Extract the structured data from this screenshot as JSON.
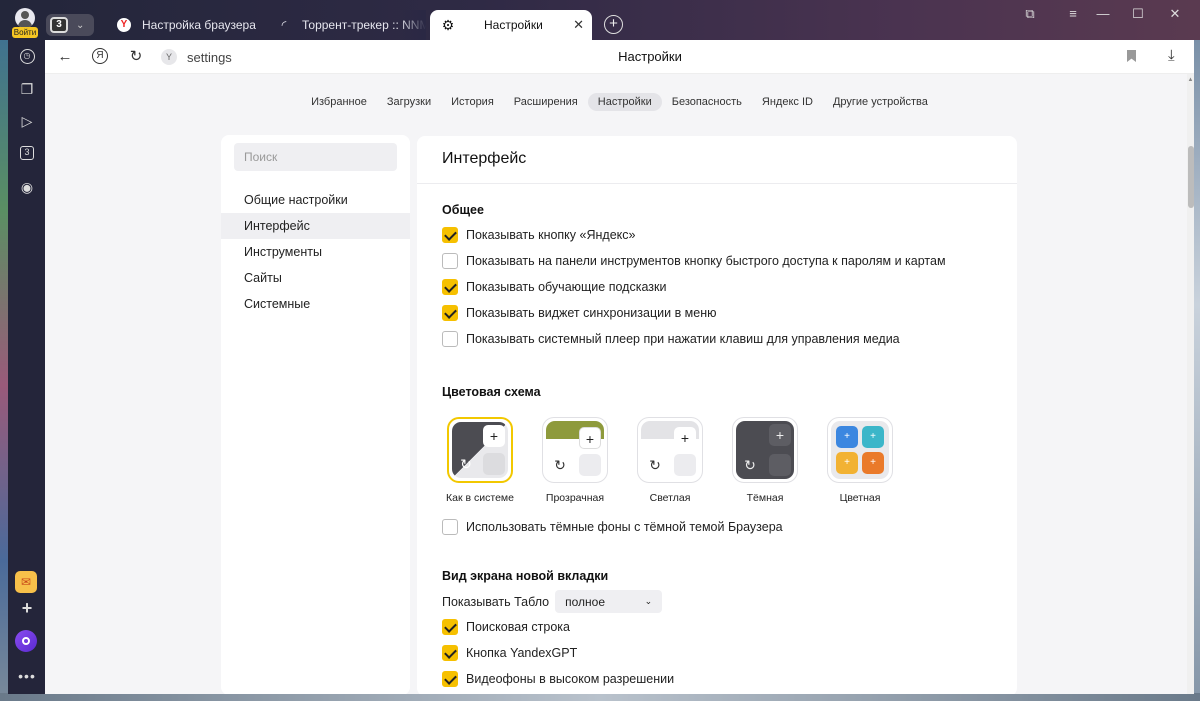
{
  "titlebar": {
    "profile_label": "Войти",
    "tab_count": "3",
    "tabs": [
      {
        "title": "Настройка браузера",
        "icon": "yandex-icon"
      },
      {
        "title": "Торрент-трекер :: NNM-C",
        "icon": "loading-icon"
      },
      {
        "title": "Настройки",
        "icon": "gear-icon",
        "close": "✕"
      }
    ],
    "new_tab": "+",
    "window_controls": [
      "⧉",
      "▭",
      "—",
      "☐",
      "✕"
    ]
  },
  "sidebar": {
    "zen_badge": "3",
    "more": "•••",
    "add": "+"
  },
  "addressbar": {
    "url": "settings",
    "page_title": "Настройки",
    "yandex_btn": "Я"
  },
  "topnav": {
    "items": [
      "Избранное",
      "Загрузки",
      "История",
      "Расширения",
      "Настройки",
      "Безопасность",
      "Яндекс ID",
      "Другие устройства"
    ],
    "active_index": 4
  },
  "settings_menu": {
    "search_placeholder": "Поиск",
    "items": [
      "Общие настройки",
      "Интерфейс",
      "Инструменты",
      "Сайты",
      "Системные"
    ],
    "active_index": 1
  },
  "main": {
    "title": "Интерфейс",
    "general": {
      "heading": "Общее",
      "options": [
        {
          "label": "Показывать кнопку «Яндекс»",
          "checked": true
        },
        {
          "label": "Показывать на панели инструментов кнопку быстрого доступа к паролям и картам",
          "checked": false
        },
        {
          "label": "Показывать обучающие подсказки",
          "checked": true
        },
        {
          "label": "Показывать виджет синхронизации в меню",
          "checked": true
        },
        {
          "label": "Показывать системный плеер при нажатии клавиш для управления медиа",
          "checked": false
        }
      ]
    },
    "color_scheme": {
      "heading": "Цветовая схема",
      "themes": [
        {
          "label": "Как в системе",
          "selected": true
        },
        {
          "label": "Прозрачная",
          "selected": false
        },
        {
          "label": "Светлая",
          "selected": false
        },
        {
          "label": "Тёмная",
          "selected": false
        },
        {
          "label": "Цветная",
          "selected": false
        }
      ],
      "dark_bg_option": {
        "label": "Использовать тёмные фоны с тёмной темой Браузера",
        "checked": false
      }
    },
    "new_tab": {
      "heading": "Вид экрана новой вкладки",
      "show_tablo_label": "Показывать Табло",
      "show_tablo_value": "полное",
      "options": [
        {
          "label": "Поисковая строка",
          "checked": true
        },
        {
          "label": "Кнопка YandexGPT",
          "checked": true
        },
        {
          "label": "Видеофоны в высоком разрешении",
          "checked": true
        }
      ]
    }
  },
  "colors": {
    "accent": "#f6c000",
    "page_bg": "#f5f5f7",
    "dark": "#4c4c52"
  }
}
